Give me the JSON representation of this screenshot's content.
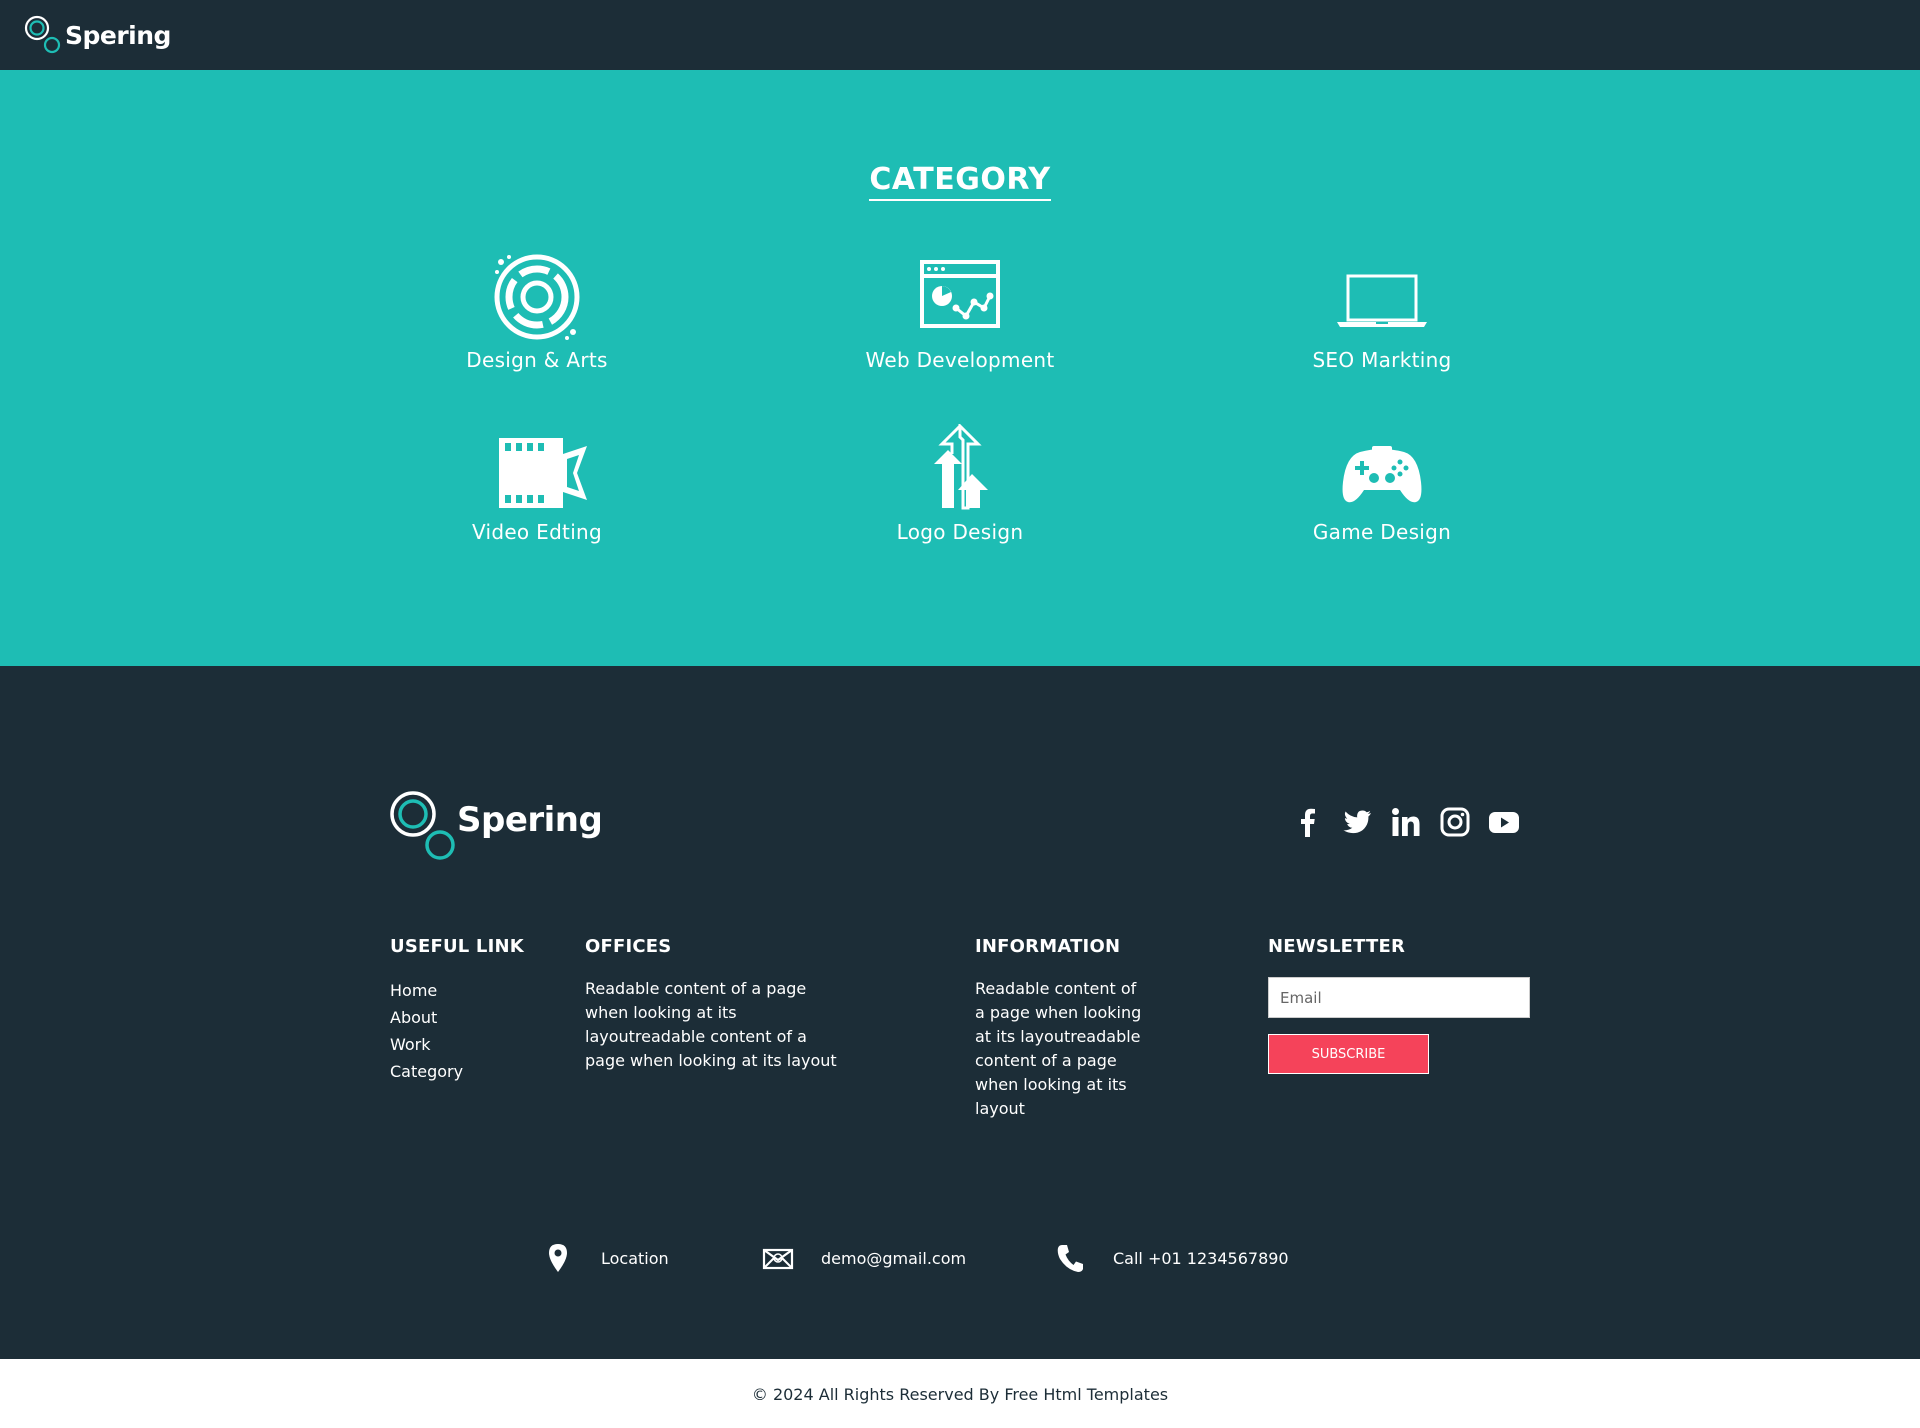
{
  "header": {
    "brand": "Spering"
  },
  "category": {
    "title": "CATEGORY",
    "items": [
      {
        "label": "Design & Arts",
        "icon": "palette-icon"
      },
      {
        "label": "Web Development",
        "icon": "browser-chart-icon"
      },
      {
        "label": "SEO Markting",
        "icon": "laptop-icon"
      },
      {
        "label": "Video Edting",
        "icon": "film-camera-icon"
      },
      {
        "label": "Logo Design",
        "icon": "arrows-up-icon"
      },
      {
        "label": "Game Design",
        "icon": "gamepad-icon"
      }
    ]
  },
  "footer": {
    "brand": "Spering",
    "social": [
      "facebook-icon",
      "twitter-icon",
      "linkedin-icon",
      "instagram-icon",
      "youtube-icon"
    ],
    "useful_link": {
      "title": "USEFUL LINK",
      "links": [
        "Home",
        "About",
        "Work",
        "Category"
      ]
    },
    "offices": {
      "title": "OFFICES",
      "text": "Readable content of a page when looking at its layoutreadable content of a page when looking at its layout"
    },
    "information": {
      "title": "INFORMATION",
      "text": "Readable content of a page when looking at its layoutreadable content of a page when looking at its layout"
    },
    "newsletter": {
      "title": "NEWSLETTER",
      "email_placeholder": "Email",
      "email_value": "",
      "subscribe_label": "SUBSCRIBE"
    },
    "contact": {
      "location": "Location",
      "email": "demo@gmail.com",
      "phone": "Call +01 1234567890"
    }
  },
  "copyright": "© 2024 All Rights Reserved By Free Html Templates",
  "colors": {
    "dark": "#1c2d37",
    "teal": "#1ebdb4",
    "accent": "#f5435a"
  }
}
